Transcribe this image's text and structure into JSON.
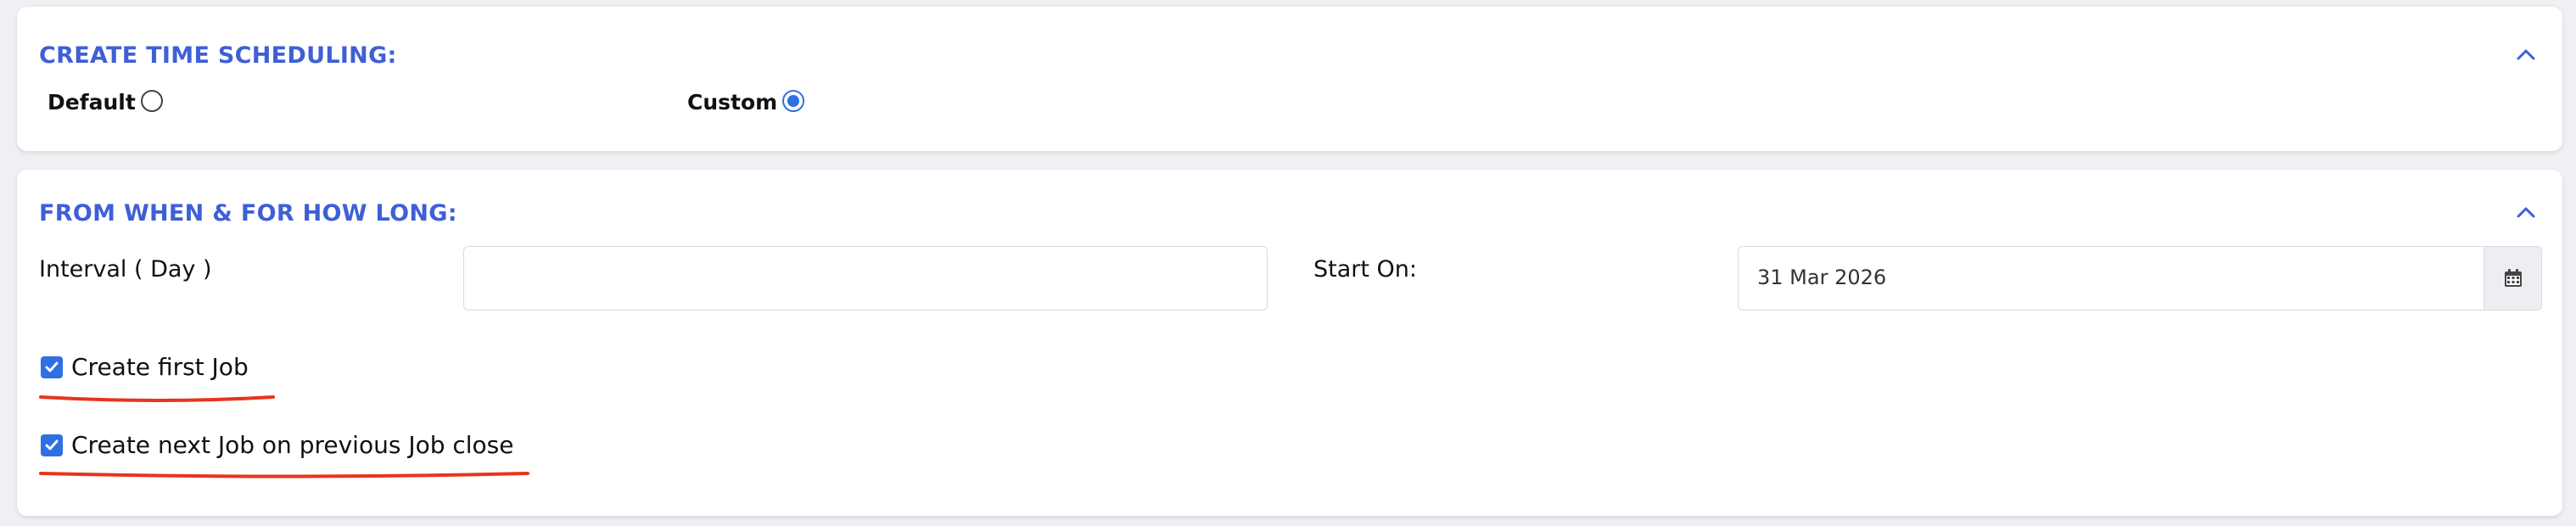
{
  "scheduling": {
    "title": "CREATE TIME SCHEDULING:",
    "options": {
      "default_label": "Default",
      "custom_label": "Custom",
      "selected": "Custom"
    }
  },
  "duration": {
    "title": "FROM WHEN & FOR HOW LONG:",
    "interval_label": "Interval ( Day )",
    "interval_value": "",
    "start_label": "Start On:",
    "start_value": "31 Mar 2026",
    "create_first_job_label": "Create first Job",
    "create_first_job_checked": true,
    "create_next_job_label": "Create next Job on previous Job close",
    "create_next_job_checked": true
  },
  "icons": {
    "collapse": "chevron-up-icon",
    "calendar": "calendar-icon",
    "check": "check-icon"
  },
  "colors": {
    "accent": "#3f5fd6",
    "radio_checked": "#2f6fe4",
    "annotation": "#e8341c"
  }
}
